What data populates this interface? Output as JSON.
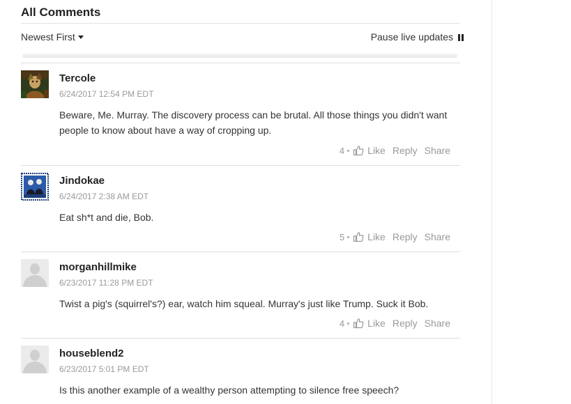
{
  "header": {
    "title": "All Comments",
    "sort_label": "Newest First",
    "pause_label": "Pause live updates"
  },
  "comments": [
    {
      "author": "Tercole",
      "date": "6/24/2017 12:54 PM EDT",
      "body": "Beware, Me. Murray. The discovery process can be brutal. All those things you didn't want people to know about have a way of cropping up.",
      "likes": "4",
      "like_label": "Like",
      "reply_label": "Reply",
      "share_label": "Share"
    },
    {
      "author": "Jindokae",
      "date": "6/24/2017 2:38 AM EDT",
      "body": "Eat sh*t and die, Bob.",
      "likes": "5",
      "like_label": "Like",
      "reply_label": "Reply",
      "share_label": "Share"
    },
    {
      "author": "morganhillmike",
      "date": "6/23/2017 11:28 PM EDT",
      "body": "Twist a pig's (squirrel's?) ear, watch him squeal. Murray's just like Trump. Suck it Bob.",
      "likes": "4",
      "like_label": "Like",
      "reply_label": "Reply",
      "share_label": "Share"
    },
    {
      "author": "houseblend2",
      "date": "6/23/2017 5:01 PM EDT",
      "body": "Is this another example of a wealthy person attempting to silence free speech?"
    }
  ]
}
